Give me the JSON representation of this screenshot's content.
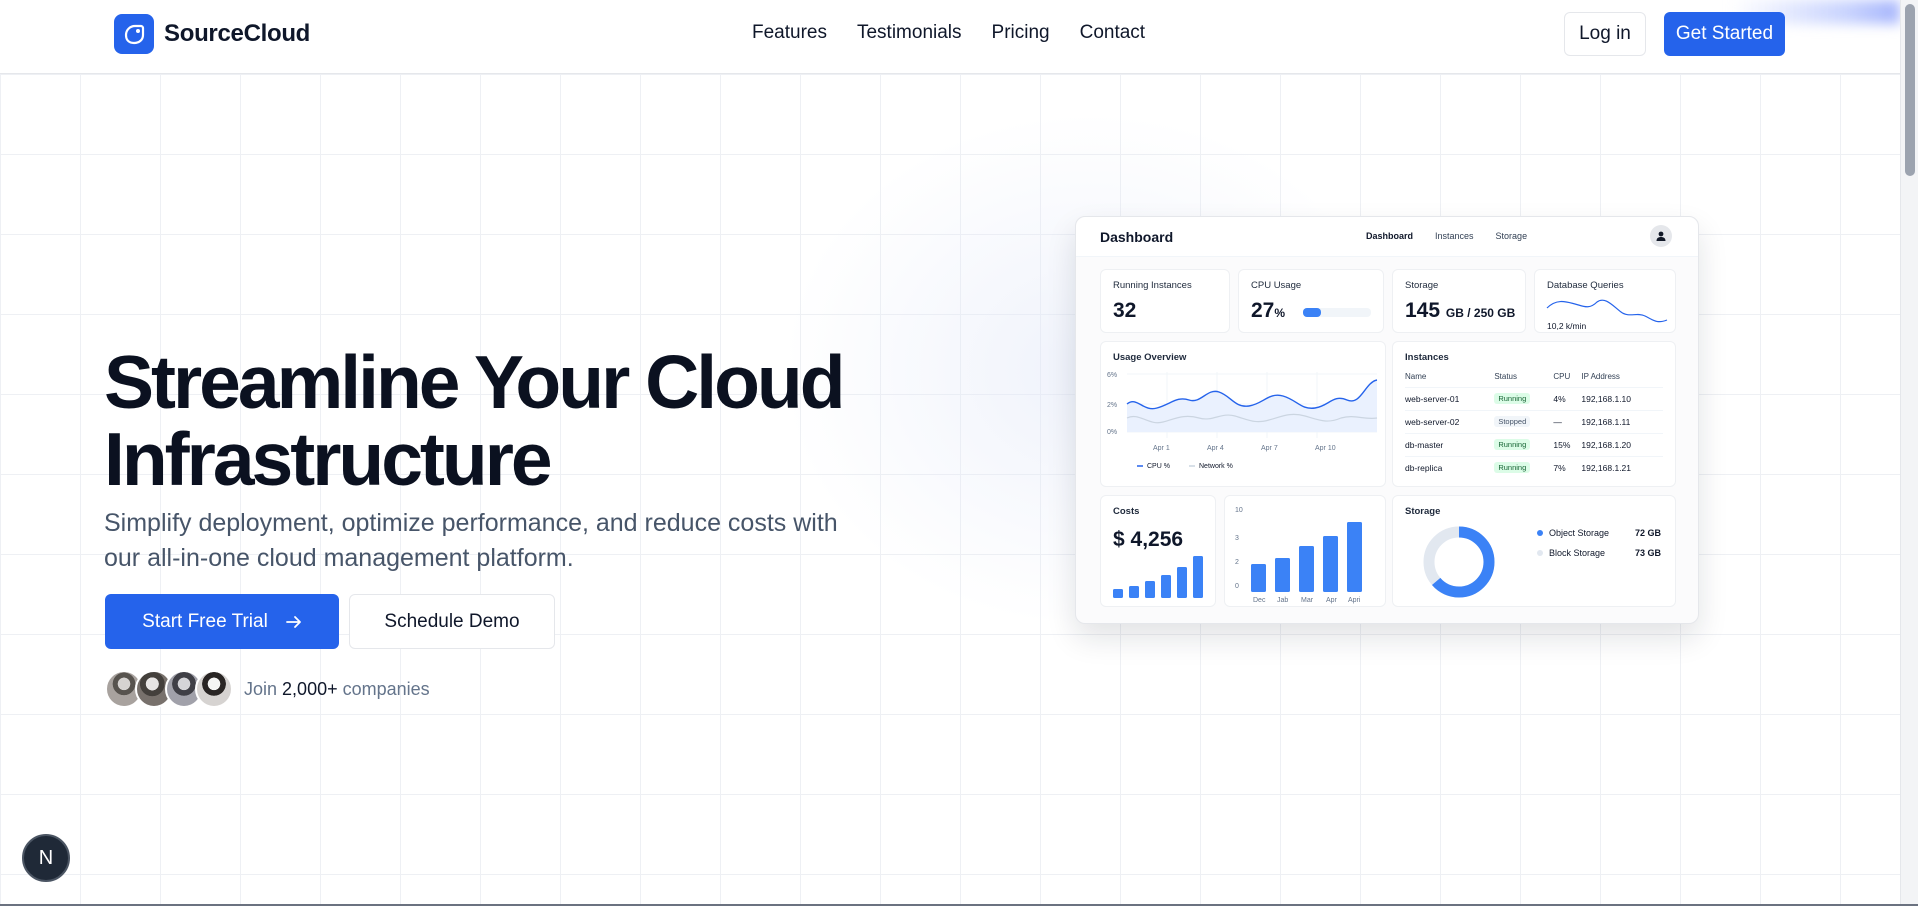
{
  "brand": {
    "name": "SourceCloud",
    "logo_icon": "cloud-logo-icon",
    "accent": "#2563eb"
  },
  "nav": {
    "items": [
      "Features",
      "Testimonials",
      "Pricing",
      "Contact"
    ]
  },
  "header": {
    "login_label": "Log in",
    "get_started_label": "Get Started"
  },
  "hero": {
    "title_line1": "Streamline Your Cloud",
    "title_line2": "Infrastructure",
    "subtitle": "Simplify deployment, optimize performance, and reduce costs with our all-in-one cloud management platform.",
    "primary_cta": "Start Free Trial",
    "secondary_cta": "Schedule Demo",
    "join_prefix": "Join",
    "join_count": "2,000+",
    "join_suffix": "companies"
  },
  "floating_badge": {
    "letter": "N"
  },
  "dashboard": {
    "title": "Dashboard",
    "tabs": [
      "Dashboard",
      "Instances",
      "Storage"
    ],
    "stats": {
      "running_label": "Running Instances",
      "running_value": "32",
      "cpu_label": "CPU Usage",
      "cpu_value": "27",
      "cpu_unit": "%",
      "cpu_fraction": 0.27,
      "storage_label": "Storage",
      "storage_value": "145",
      "storage_unit": "GB / 250 GB",
      "db_label": "Database Queries",
      "db_value": "10,2 k/min"
    },
    "usage": {
      "title": "Usage Overview",
      "y_ticks": [
        "6%",
        "2%",
        "0%"
      ],
      "x_ticks": [
        "Apr 1",
        "Apr 4",
        "Apr 7",
        "Apr 10"
      ],
      "legend": [
        "CPU %",
        "Network %"
      ]
    },
    "instances": {
      "title": "Instances",
      "columns": [
        "Name",
        "Status",
        "CPU",
        "IP Address"
      ],
      "rows": [
        {
          "name": "web-server-01",
          "status": "Running",
          "cpu": "4%",
          "ip": "192,168.1.10"
        },
        {
          "name": "web-server-02",
          "status": "Stopped",
          "cpu": "—",
          "ip": "192,168.1.11"
        },
        {
          "name": "db-master",
          "status": "Running",
          "cpu": "15%",
          "ip": "192,168.1.20"
        },
        {
          "name": "db-replica",
          "status": "Running",
          "cpu": "7%",
          "ip": "192,168.1.21"
        }
      ]
    },
    "costs": {
      "title": "Costs",
      "value": "$ 4,256"
    },
    "cost_chart": {
      "y_ticks": [
        "10",
        "3",
        "2",
        "0"
      ],
      "x_ticks": [
        "Dec",
        "Jab",
        "Mar",
        "Apr",
        "Apri"
      ]
    },
    "storage_breakdown": {
      "title": "Storage",
      "items": [
        {
          "label": "Object Storage",
          "value": "72 GB",
          "color": "#3b82f6"
        },
        {
          "label": "Block Storage",
          "value": "73 GB",
          "color": "#e2e8f0"
        }
      ]
    }
  }
}
